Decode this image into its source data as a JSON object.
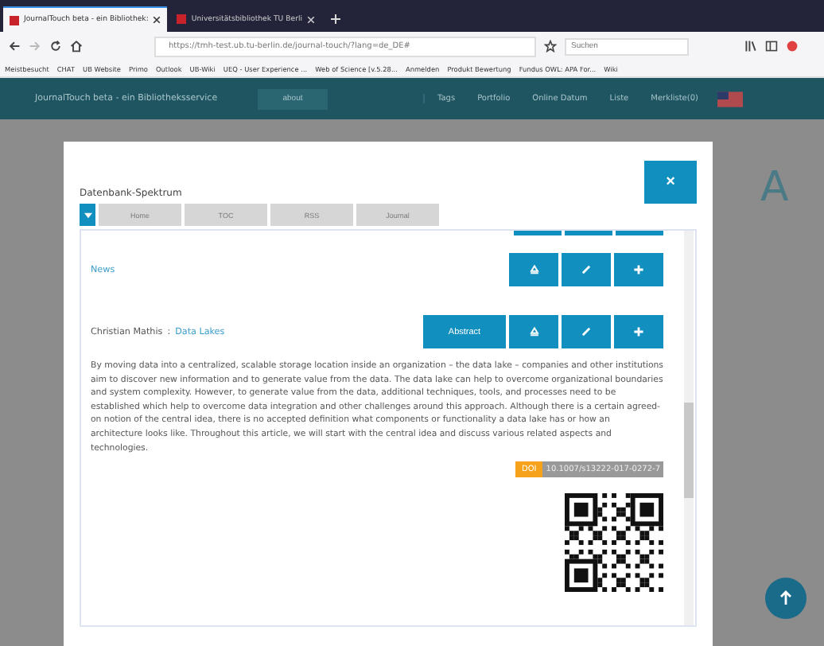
{
  "browser": {
    "tabs": [
      {
        "title": "JournalTouch beta - ein Bibliothek:",
        "selected": true
      },
      {
        "title": "Universitätsbibliothek TU Berli",
        "selected": false
      }
    ],
    "url": "https://tmh-test.ub.tu-berlin.de/journal-touch/?lang=de_DE#",
    "search": {
      "placeholder": "Suchen"
    },
    "bookmarks": [
      "Meistbesucht",
      "CHAT",
      "UB Website",
      "Primo",
      "Outlook",
      "UB-Wiki",
      "UEQ - User Experience ...",
      "Web of Science [v.5.28...",
      "Anmelden",
      "Produkt Bewertung",
      "Fundus OWL: APA For...",
      "Wiki"
    ]
  },
  "app_bar": {
    "title": "JournalTouch beta - ein Bibliotheksservice",
    "about": "about",
    "menu": [
      "Tags",
      "Portfolio",
      "Online Datum",
      "Liste",
      "Merkliste(0)"
    ]
  },
  "background_letter": "A",
  "modal": {
    "title": "Datenbank-Spektrum",
    "close": "×",
    "tabs": [
      {
        "label": "Home",
        "disabled": true
      },
      {
        "label": "TOC",
        "disabled": true
      },
      {
        "label": "RSS",
        "disabled": true
      },
      {
        "label": "Journal",
        "disabled": true
      }
    ],
    "articles": [
      {
        "title": "News",
        "buttons": [
          {
            "kind": "icon"
          },
          {
            "kind": "icon"
          },
          {
            "kind": "icon"
          }
        ]
      },
      {
        "author": "Christian Mathis",
        "separator": ":",
        "title": "Data Lakes",
        "buttons": [
          {
            "kind": "label",
            "label": "Abstract"
          },
          {
            "kind": "icon"
          },
          {
            "kind": "icon"
          },
          {
            "kind": "icon"
          }
        ],
        "abstract": "By moving data into a centralized, scalable storage location inside an organization – the data lake – companies and other institutions aim to discover new information and to generate value from the data. The data lake can help to overcome organizational boundaries and system complexity. However, to generate value from the data, additional techniques, tools, and processes need to be established which help to overcome data integration and other challenges around this approach. Although there is a certain agreed-on notion of the central idea, there is no accepted definition what components or functionality a data lake has or how an architecture looks like. Throughout this article, we will start with the central idea and discuss various related aspects and technologies.",
        "doi_label": "DOI",
        "doi": "10.1007/s13222-017-0272-7"
      }
    ]
  }
}
